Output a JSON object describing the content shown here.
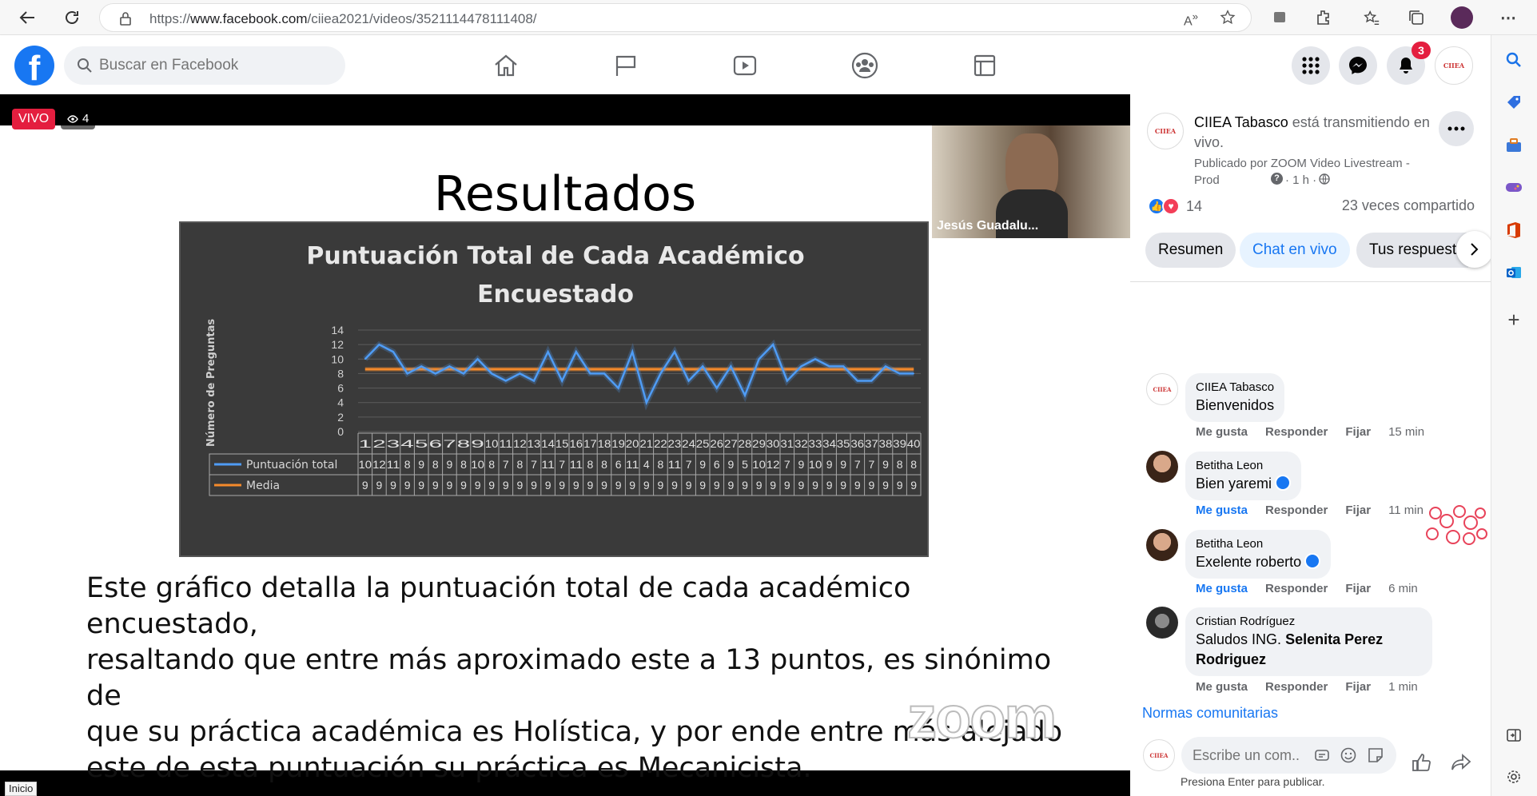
{
  "browser": {
    "url_prefix": "https://",
    "url_domain": "www.facebook.com",
    "url_path": "/ciiea2021/videos/3521114478111408/"
  },
  "header": {
    "logo": "f",
    "search_placeholder": "Buscar en Facebook",
    "notification_count": "3"
  },
  "video": {
    "live_badge": "VIVO",
    "viewer_count": "4",
    "slide_title": "Resultados",
    "chart_title_line1": "Puntuación Total de Cada Académico",
    "chart_title_line2": "Encuestado",
    "body_text_lines": [
      "Este gráfico detalla la puntuación total de cada académico encuestado,",
      "resaltando que entre más aproximado este a 13 puntos, es sinónimo de",
      "que su práctica académica es Holística, y por ende entre más alejado",
      "este de esta puntuación su práctica es Mecanicista."
    ],
    "watermark": "zoom",
    "pip_name": "Jesús Guadalu...",
    "status_text": "Inicio"
  },
  "chart_data": {
    "type": "line",
    "title": "Puntuación Total de Cada Académico Encuestado",
    "ylabel": "Número de Preguntas",
    "ylim": [
      0,
      14
    ],
    "yticks": [
      0,
      2,
      4,
      6,
      8,
      10,
      12,
      14
    ],
    "categories": [
      "1",
      "2",
      "3",
      "4",
      "5",
      "6",
      "7",
      "8",
      "9",
      "10",
      "11",
      "12",
      "13",
      "14",
      "15",
      "16",
      "17",
      "18",
      "19",
      "20",
      "21",
      "22",
      "23",
      "24",
      "25",
      "26",
      "27",
      "28",
      "29",
      "30",
      "31",
      "32",
      "33",
      "34",
      "35",
      "36",
      "37",
      "38",
      "39",
      "40"
    ],
    "series": [
      {
        "name": "Puntuación total",
        "color": "#4f9cf5",
        "values": [
          10,
          12,
          11,
          8,
          9,
          8,
          9,
          8,
          10,
          8,
          7,
          8,
          7,
          11,
          7,
          11,
          8,
          8,
          6,
          11,
          4,
          8,
          11,
          7,
          9,
          6,
          9,
          5,
          10,
          12,
          7,
          9,
          10,
          9,
          9,
          7,
          7,
          9,
          8,
          8
        ]
      },
      {
        "name": "Media",
        "color": "#f58a2b",
        "values": [
          9,
          9,
          9,
          9,
          9,
          9,
          9,
          9,
          9,
          9,
          9,
          9,
          9,
          9,
          9,
          9,
          9,
          9,
          9,
          9,
          9,
          9,
          9,
          9,
          9,
          9,
          9,
          9,
          9,
          9,
          9,
          9,
          9,
          9,
          9,
          9,
          9,
          9,
          9,
          9
        ]
      }
    ],
    "media_level": 8.6,
    "grid": true,
    "legend": "table-bottom"
  },
  "post": {
    "page_name": "CIIEA Tabasco",
    "action": " está transmitiendo en vivo.",
    "published_by": "Publicado por ZOOM Video Livestream - Prod",
    "time": "· 1 h ·",
    "reaction_count": "14",
    "shares": "23 veces compartido",
    "tabs": [
      "Resumen",
      "Chat en vivo",
      "Tus respuestas"
    ]
  },
  "comments": [
    {
      "author": "CIIEA Tabasco",
      "text": "Bienvenidos",
      "time": "15 min",
      "liked": false
    },
    {
      "author": "Betitha Leon",
      "text": "Bien yaremi",
      "time": "11 min",
      "liked": true
    },
    {
      "author": "Betitha Leon",
      "text": "Exelente roberto",
      "time": "6 min",
      "liked": true
    },
    {
      "author": "Cristian Rodríguez",
      "text_prefix": "Saludos ING. ",
      "text_bold": "Selenita Perez Rodriguez",
      "time": "1 min",
      "liked": false
    }
  ],
  "comment_actions": {
    "like": "Me gusta",
    "reply": "Responder",
    "pin": "Fijar"
  },
  "footer": {
    "community": "Normas comunitarias",
    "composer_placeholder": "Escribe un com...",
    "hint": "Presiona Enter para publicar."
  },
  "colors": {
    "facebook_blue": "#1877f2",
    "live_red": "#e41e3f",
    "chart_bg": "#3a3a3a"
  }
}
